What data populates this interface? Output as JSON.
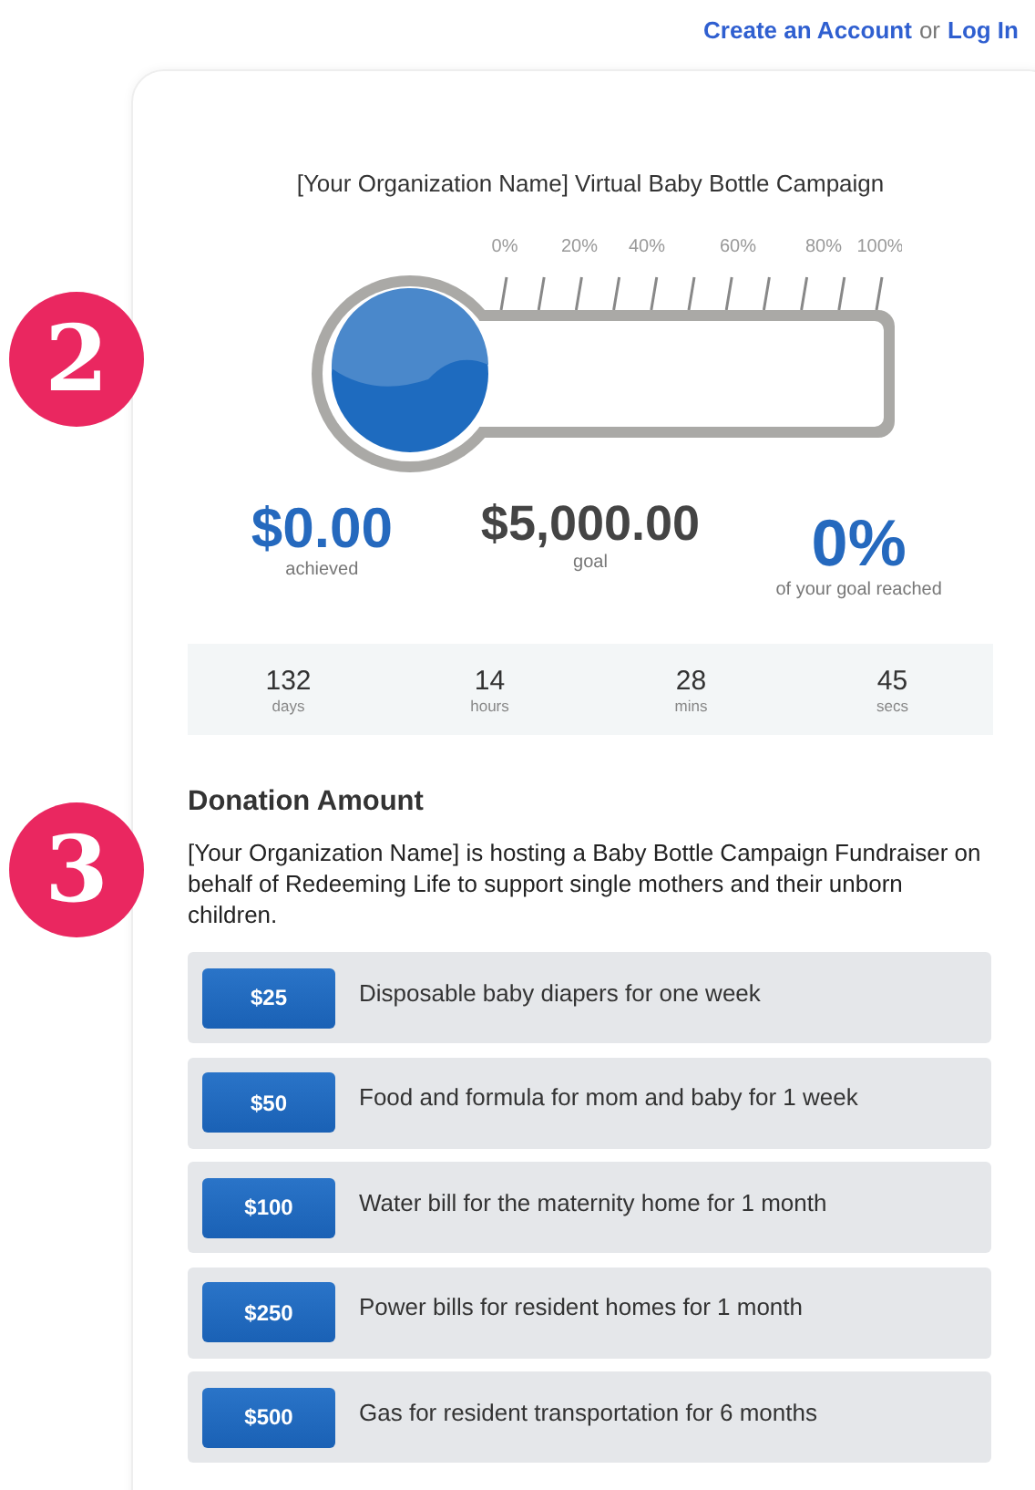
{
  "header": {
    "create_account": "Create an Account",
    "separator": "or",
    "log_in": "Log In"
  },
  "step_badges": [
    {
      "number": "2"
    },
    {
      "number": "3"
    }
  ],
  "campaign": {
    "title": "[Your Organization Name] Virtual Baby Bottle Campaign",
    "thermometer": {
      "ticks": [
        "0%",
        "20%",
        "40%",
        "60%",
        "80%",
        "100%"
      ]
    },
    "stats": [
      {
        "value": "$0.00",
        "label": "achieved",
        "kind": "accent"
      },
      {
        "value": "$5,000.00",
        "label": "goal",
        "kind": "plain"
      },
      {
        "value": "0%",
        "label": "of your goal reached",
        "kind": "accent"
      }
    ],
    "countdown": [
      {
        "value": "132",
        "unit": "days"
      },
      {
        "value": "14",
        "unit": "hours"
      },
      {
        "value": "28",
        "unit": "mins"
      },
      {
        "value": "45",
        "unit": "secs"
      }
    ]
  },
  "donation": {
    "heading": "Donation Amount",
    "description": "[Your Organization Name] is hosting a Baby Bottle Campaign Fundraiser on behalf of Redeeming Life to support single mothers and their unborn children.",
    "options": [
      {
        "amount": "$25",
        "text": "Disposable baby diapers for one week"
      },
      {
        "amount": "$50",
        "text": "Food and formula for mom and baby for 1 week"
      },
      {
        "amount": "$100",
        "text": "Water bill for the maternity home for 1 month"
      },
      {
        "amount": "$250",
        "text": "Power bills for resident homes for 1 month"
      },
      {
        "amount": "$500",
        "text": "Gas for resident transportation for 6 months"
      }
    ]
  }
}
